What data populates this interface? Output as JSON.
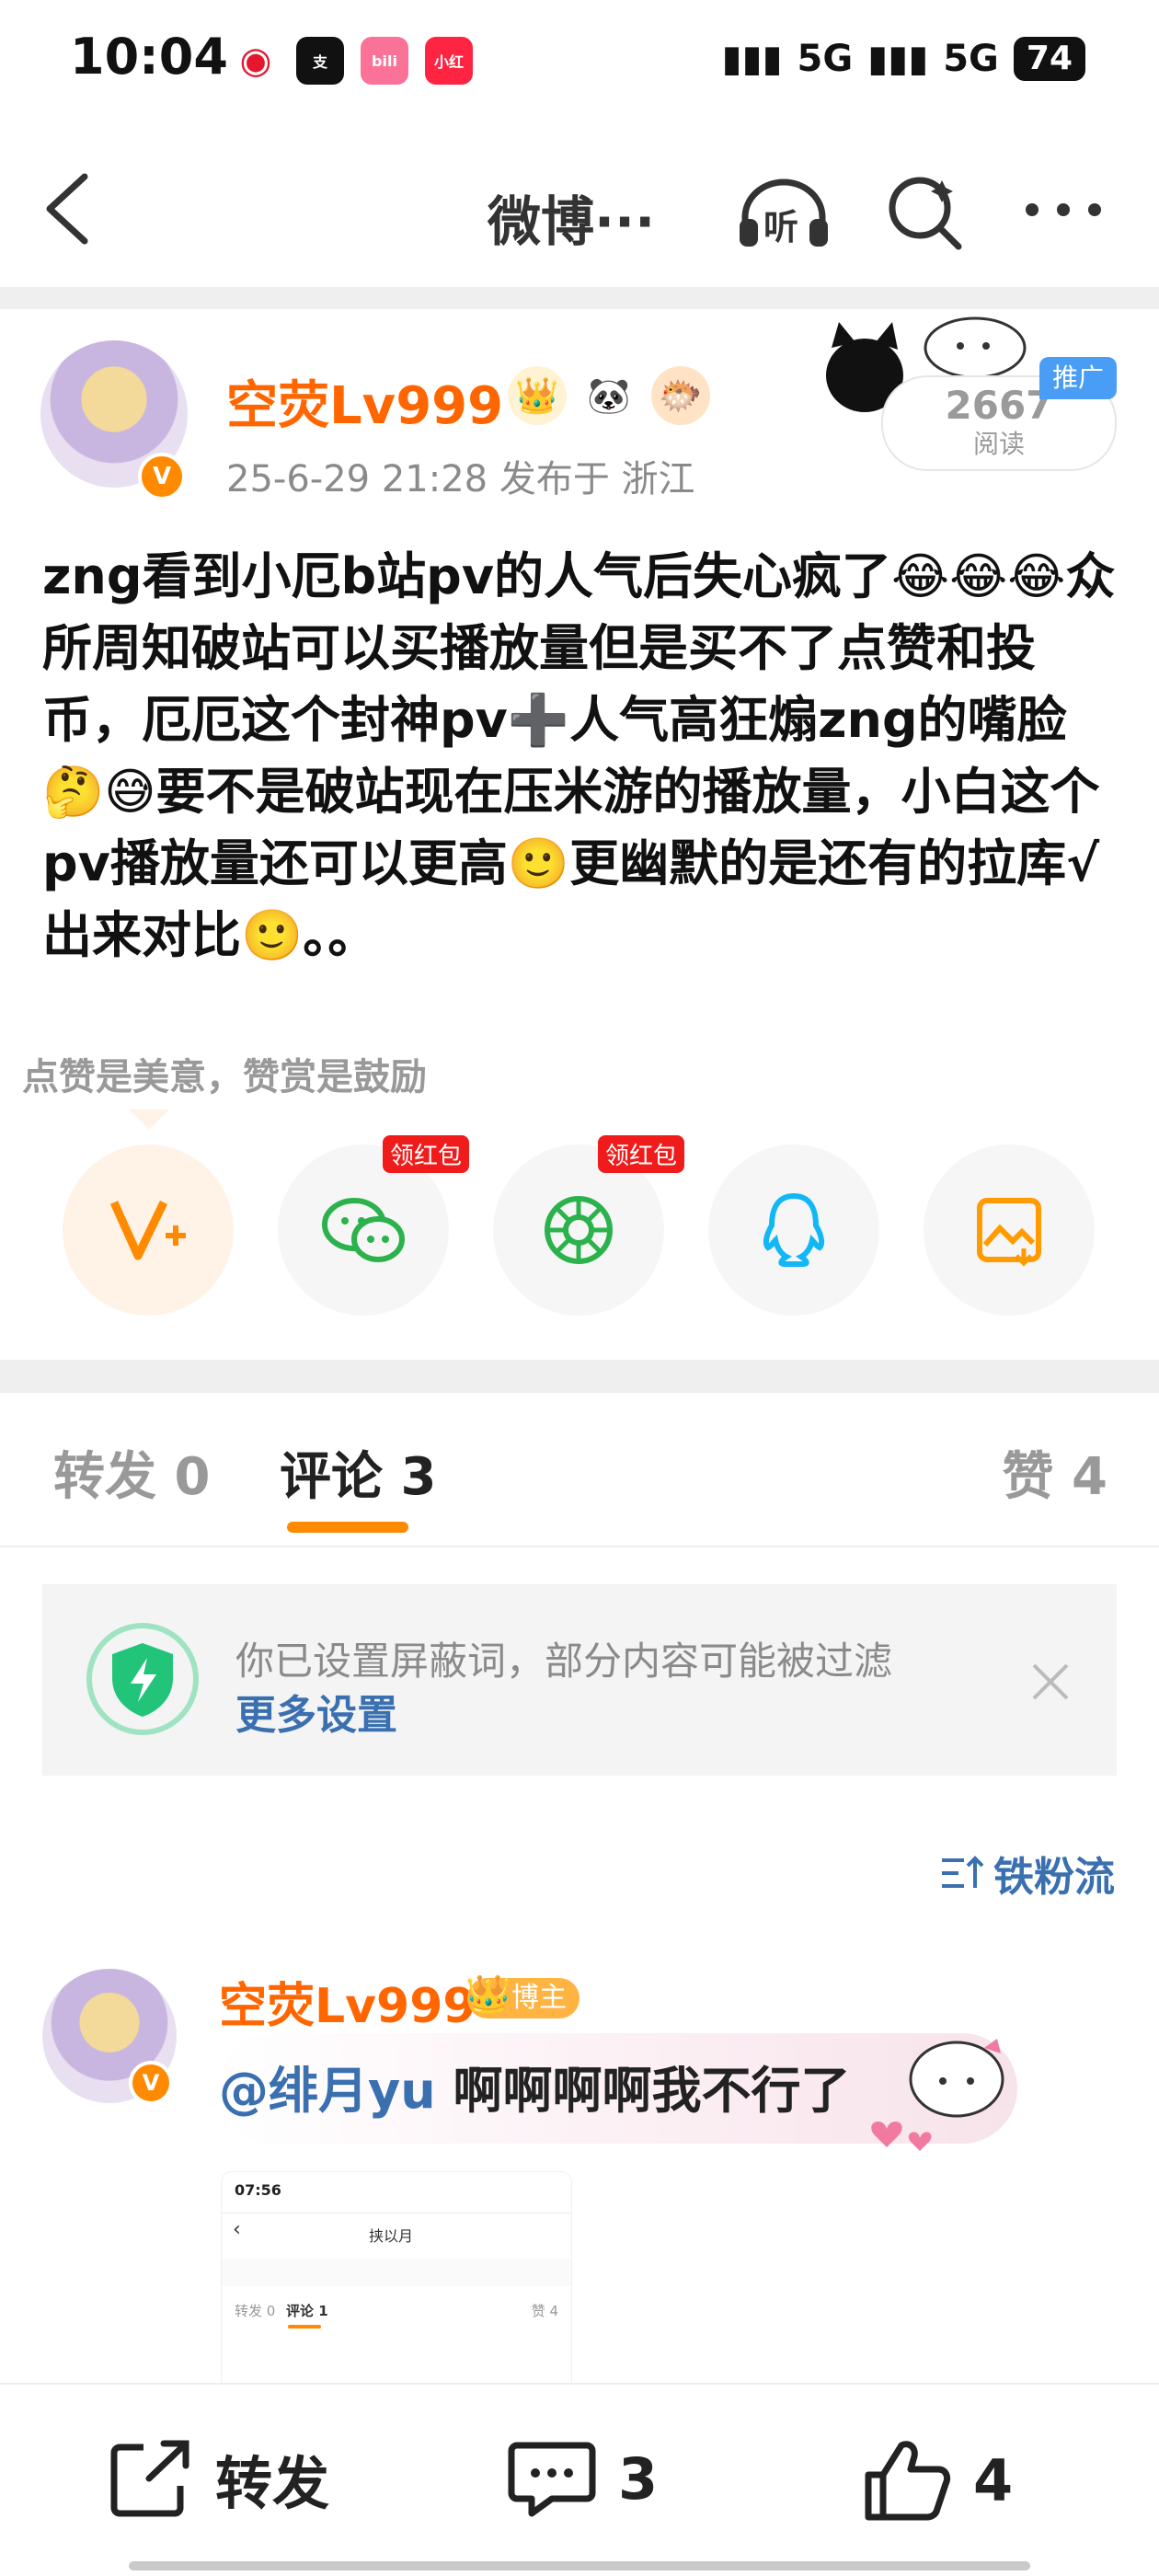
{
  "status_bar": {
    "time": "10:04",
    "signal1": "5G",
    "signal2": "5G",
    "battery": "74"
  },
  "header": {
    "title": "微博···",
    "listen_label": "听"
  },
  "post": {
    "author": "空荧Lv999",
    "meta": "25-6-29 21:28   发布于 浙江",
    "read_count": "2667",
    "read_label": "阅读",
    "promo_tag": "推广",
    "body": "zng看到小厄b站pv的人气后失心疯了😂😂😂众所周知破站可以买播放量但是买不了点赞和投币，厄厄这个封神pv➕人气高狂煽zng的嘴脸🤔😅要不是破站现在压米游的播放量，小白这个pv播放量还可以更高🙂更幽默的是还有的拉库√出来对比🙂。。",
    "reward_hint": "点赞是美意，赞赏是鼓励",
    "share": [
      {
        "name": "reward",
        "badge": ""
      },
      {
        "name": "wechat",
        "badge": "领红包"
      },
      {
        "name": "moments",
        "badge": "领红包"
      },
      {
        "name": "qq",
        "badge": ""
      },
      {
        "name": "save-image",
        "badge": ""
      }
    ]
  },
  "tabs": {
    "repost": "转发 0",
    "comment": "评论 3",
    "like": "赞 4"
  },
  "notice": {
    "text": "你已设置屏蔽词，部分内容可能被过滤",
    "link": "更多设置"
  },
  "sort": {
    "label": "铁粉流"
  },
  "comment": {
    "author": "空荧Lv999",
    "badge": "博主",
    "mention": "@绯月yu",
    "text": " 啊啊啊啊我不行了",
    "thumb": {
      "time": "07:56",
      "title": "挟以月",
      "tab_repost": "转发 0",
      "tab_comment": "评论 1",
      "tab_like": "赞 4"
    }
  },
  "bottom_bar": {
    "repost": "转发",
    "comment_count": "3",
    "like_count": "4"
  },
  "colors": {
    "accent": "#ff8a00",
    "author": "#ff6600",
    "link": "#3a6fb0",
    "redpack": "#f01c1c"
  }
}
